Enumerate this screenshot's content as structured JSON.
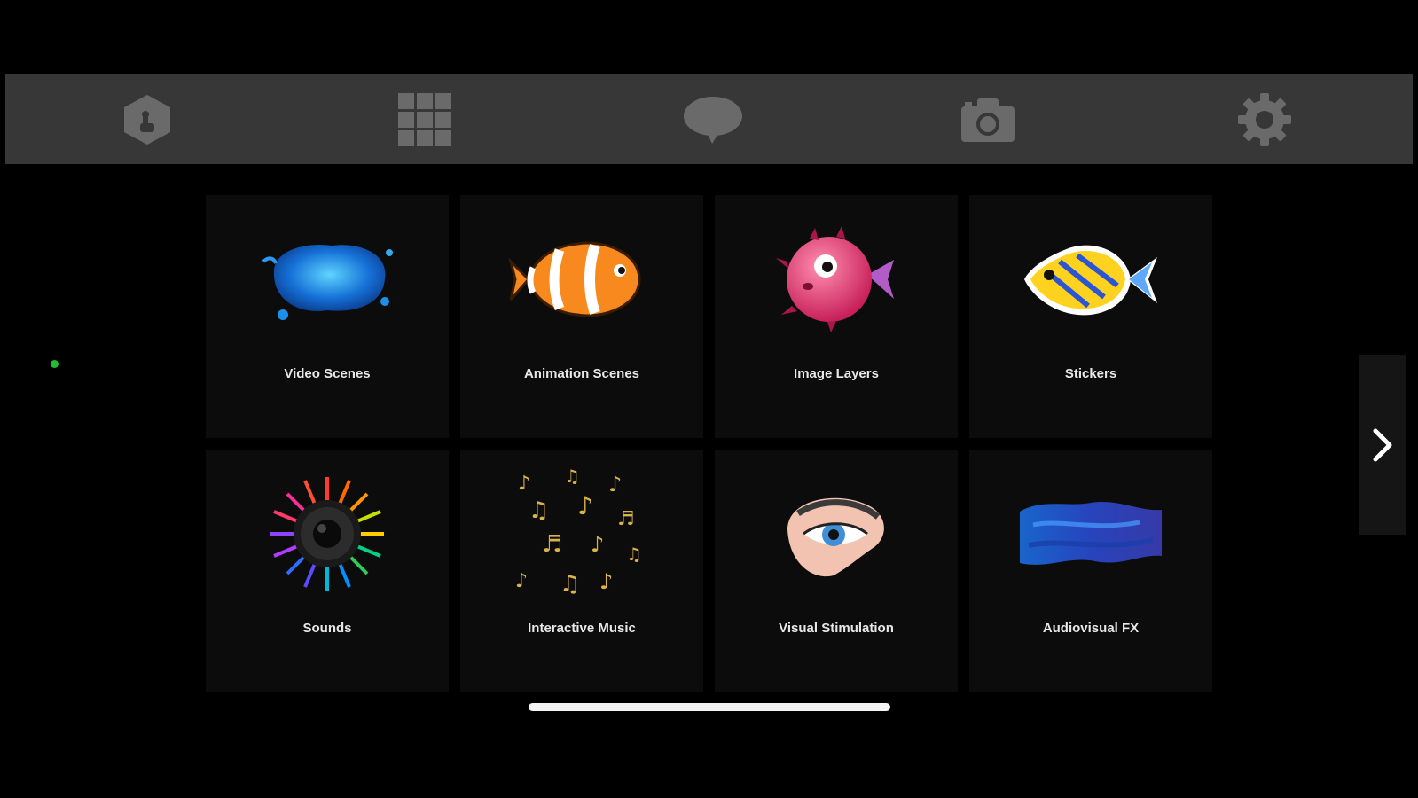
{
  "toolbar": {
    "items": [
      {
        "icon": "hand-hexagon-icon"
      },
      {
        "icon": "grid-icon"
      },
      {
        "icon": "chat-bubble-icon"
      },
      {
        "icon": "camera-icon"
      },
      {
        "icon": "gear-icon"
      }
    ],
    "icon_color": "#6a6a6a",
    "background": "#373737"
  },
  "status_indicator": {
    "color": "#1fbf2f"
  },
  "tiles": [
    {
      "label": "Video Scenes",
      "icon": "blue-water-splash-icon"
    },
    {
      "label": "Animation Scenes",
      "icon": "clownfish-icon"
    },
    {
      "label": "Image Layers",
      "icon": "pufferfish-icon"
    },
    {
      "label": "Stickers",
      "icon": "yellow-fish-icon"
    },
    {
      "label": "Sounds",
      "icon": "speaker-burst-icon"
    },
    {
      "label": "Interactive Music",
      "icon": "music-notes-icon"
    },
    {
      "label": "Visual Stimulation",
      "icon": "eye-icon"
    },
    {
      "label": "Audiovisual FX",
      "icon": "blue-smoke-icon"
    }
  ],
  "pager": {
    "next_icon": "chevron-right-icon"
  }
}
